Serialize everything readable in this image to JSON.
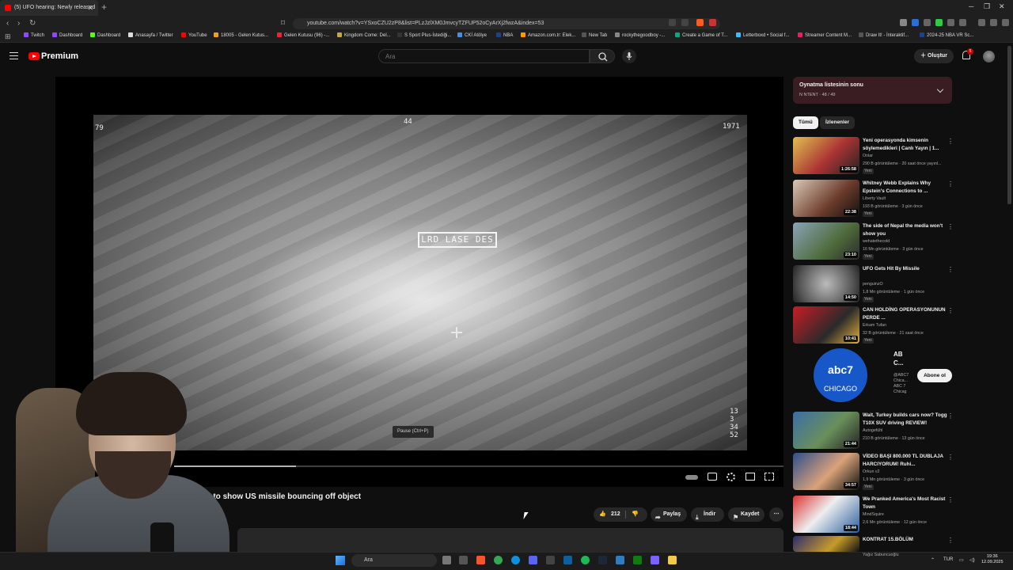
{
  "browser": {
    "tab_title": "(5) UFO hearing: Newly released",
    "url": "youtube.com/watch?v=YSxoCZU2zP8&list=PLzJzlXM0JmvcyTZFUP52oCyArXj2fwzA&index=53",
    "bookmarks": [
      "Twitch",
      "Dashboard",
      "Dashboard",
      "Anasayfa / Twitter",
      "YouTube",
      "18005 - Gelen Kutus...",
      "Gelen Kutusu (96) -...",
      "Kingdom Come: Del...",
      "S Sport Plus-İstediği...",
      "CKİ Atölye",
      "NBA",
      "Amazon.com.tr: Elek...",
      "New Tab",
      "rockythegoodboy -...",
      "Create a Game of T...",
      "Letterboxd • Social f...",
      "Streamer Content M...",
      "Draw It! - İnteraktif...",
      "2024-25 NBA VR Sc..."
    ]
  },
  "header": {
    "logo_text": "Premium",
    "search_placeholder": "Ara",
    "create_label": "Oluştur",
    "notification_count": "5"
  },
  "player": {
    "hud_label": "LRD LASE DES",
    "hud_top": "44",
    "hud_left": "79",
    "hud_right": "1971",
    "hud_bottom_right": "13\n3\n34\n52",
    "pause_tooltip": "Pause (Ctrl+P)",
    "progress": 0.2
  },
  "video": {
    "title": "ears to show US missile bouncing off object",
    "like_count": "212",
    "share_label": "Paylaş",
    "download_label": "İndir",
    "save_label": "Kaydet"
  },
  "sidebar": {
    "playlist_title": "Oynatma listesinin sonu",
    "playlist_sub": "N NTENT · 48 / 49",
    "chips": [
      "Tümü",
      "İzlenenler"
    ],
    "recommendations": [
      {
        "title": "Yeni operasyonda kimsenin söylemedikleri | Canlı Yayın | 1...",
        "channel": "Onlar",
        "meta": "290 B görüntüleme · 20 saat önce yayınl...",
        "badge": "Yeni",
        "duration": "1:26:58"
      },
      {
        "title": "Whitney Webb Explains Why Epstein's Connections to ...",
        "channel": "Liberty Vault",
        "meta": "193 B görüntüleme · 3 gün önce",
        "badge": "Yeni",
        "duration": "22:38"
      },
      {
        "title": "The side of Nepal the media won't show you",
        "channel": "wehatethecold",
        "meta": "16 Mn görüntüleme · 3 gün önce",
        "badge": "Yeni",
        "duration": "23:10"
      },
      {
        "title": "UFO Gets Hit By Missile",
        "channel": "penguinzO",
        "meta": "1,8 Mn görüntüleme · 1 gün önce",
        "badge": "Yeni",
        "duration": "14:50"
      },
      {
        "title": "CAN HOLDİNG OPERASYONUNUN PERDE ...",
        "channel": "Erkam Tufan",
        "meta": "32 B görüntüleme · 21 saat önce",
        "badge": "Yeni",
        "duration": "10:41"
      },
      {
        "title": "Wait, Turkey builds cars now? Togg T10X SUV driving REVIEW!",
        "channel": "Autogefühl",
        "meta": "210 B görüntüleme · 13 gün önce",
        "badge": "",
        "duration": "21:44"
      },
      {
        "title": "VİDEO BAŞI 800.000 TL DUBLAJA HARCIYORUM! Ruhi...",
        "channel": "Orkun v2",
        "meta": "1,9 Mn görüntüleme · 3 gün önce",
        "badge": "Yeni",
        "duration": "34:57"
      },
      {
        "title": "We Pranked America's Most Racist Town",
        "channel": "MindSquire",
        "meta": "2,6 Mn görüntüleme · 12 gün önce",
        "badge": "",
        "duration": "18:44"
      },
      {
        "title": "KONTRAT 15.BÖLÜM",
        "channel": "Yağız Sabuncuoğlu",
        "meta": "",
        "badge": "",
        "duration": ""
      }
    ],
    "ad": {
      "logo_abc": "abc7",
      "logo_city": "CHICAGO",
      "name": "AB C...",
      "handle": "@ABC7 Chica... ABC 7 Chicag",
      "subscribe_label": "Abone ol"
    }
  },
  "taskbar": {
    "search_placeholder": "Ara",
    "language": "TUR",
    "time": "19:36",
    "date": "12.09.2025"
  }
}
